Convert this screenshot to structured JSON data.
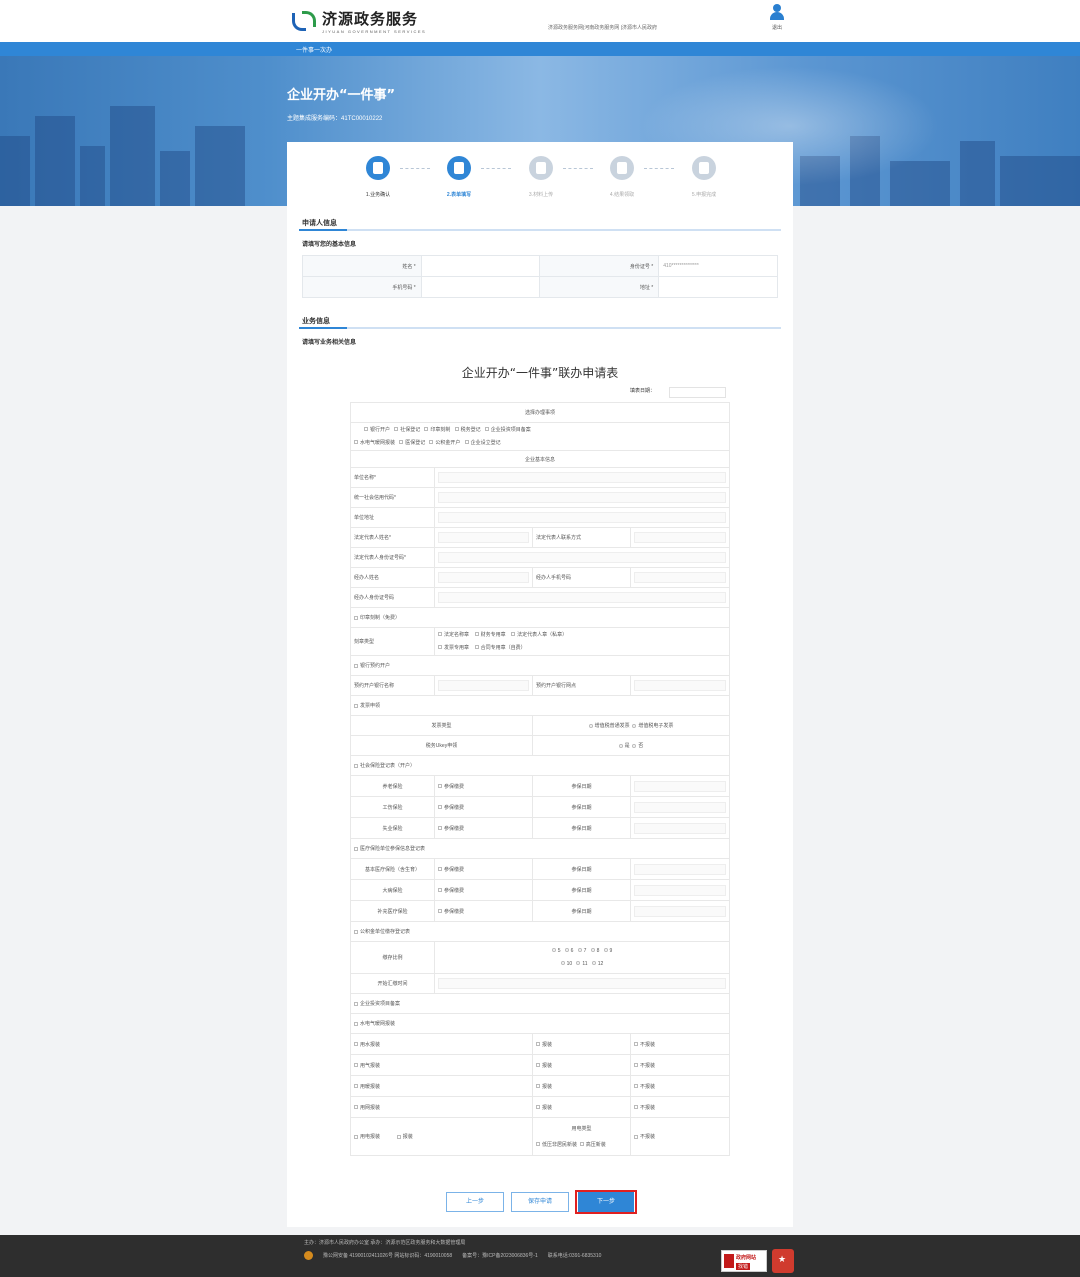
{
  "header": {
    "logo_cn": "济源政务服务",
    "logo_en": "JIYUAN GOVERNMENT SERVICES",
    "links": "济源政务服务网|河南政务服务网 |济源市人民政府",
    "logout": "退出",
    "nav": "一件事一次办"
  },
  "banner": {
    "title": "企业开办“一件事”",
    "code_label": "主题集成服务编码：",
    "code": "41TC00010222"
  },
  "steps": [
    {
      "label": "1.业务确认",
      "state": "done"
    },
    {
      "label": "2.表单填写",
      "state": "active"
    },
    {
      "label": "3.材料上传",
      "state": "todo"
    },
    {
      "label": "4.结果领取",
      "state": "todo"
    },
    {
      "label": "5.申报完成",
      "state": "todo"
    }
  ],
  "applicant": {
    "title": "申请人信息",
    "hint": "请填写您的基本信息",
    "name_label": "姓名 *",
    "id_label": "身份证号 *",
    "id_value": "410**************",
    "phone_label": "手机号码 *",
    "address_label": "地址 *"
  },
  "business": {
    "title": "业务信息",
    "hint": "请填写业务相关信息"
  },
  "form": {
    "title": "企业开办“一件事”联办申请表",
    "date_label": "填表日期：",
    "select_items": "选择办理事项",
    "items_row1": [
      "银行开户",
      "社保登记",
      "印章刻制",
      "税务登记",
      "企业投资项目备案"
    ],
    "items_row2": [
      "水电气暖网报装",
      "医保登记",
      "公积金开户",
      "企业设立登记"
    ],
    "basic_info": "企业基本信息",
    "unit_name": "单位名称*",
    "credit_code": "统一社会信用代码*",
    "unit_address": "单位地址",
    "legal_name": "法定代表人姓名*",
    "legal_contact": "法定代表人联系方式",
    "legal_id": "法定代表人身份证号码*",
    "agent_name": "经办人姓名",
    "agent_phone": "经办人手机号码",
    "agent_id": "经办人身份证号码",
    "seal_section": "印章刻制（免费）",
    "seal_type": "刻章类型",
    "seal_opts_row1": [
      "法定名称章",
      "财务专用章",
      "法定代表人章（私章）"
    ],
    "seal_opts_row2": [
      "发票专用章",
      "合同专用章（自费）"
    ],
    "bank_section": "银行预约开户",
    "bank_name": "预约开户银行名称",
    "bank_branch": "预约开户银行网点",
    "invoice_section": "发票申领",
    "invoice_type": "发票类型",
    "invoice_opts": [
      "增值税普通发票",
      "增值税电子发票"
    ],
    "ukey": "税务Ukey申领",
    "yes": "是",
    "no": "否",
    "social_section": "社会保险登记表（开户）",
    "pension": "养老保险",
    "injury": "工伤保险",
    "unemployment": "失业保险",
    "insure": "参保缴费",
    "insure_date": "参保日期",
    "medical_section": "医疗保险单位参保信息登记表",
    "basic_medical": "基本医疗保险（含生育）",
    "serious_illness": "大病保险",
    "supplementary": "补充医疗保险",
    "fund_section": "公积金单位缴存登记表",
    "deposit_ratio": "缴存比例",
    "ratios_row1": [
      "5",
      "6",
      "7",
      "8",
      "9"
    ],
    "ratios_row2": [
      "10",
      "11",
      "12"
    ],
    "start_month": "开始汇缴时间",
    "project_section": "企业投资项目备案",
    "utility_section": "水电气暖网报装",
    "utilities": [
      "用水报装",
      "用气报装",
      "用暖报装",
      "用网报装",
      "用电报装"
    ],
    "apply": "报装",
    "no_apply": "不报装",
    "power_type": "用电类型",
    "power_opts": [
      "低压非居民新装",
      "高压新装"
    ]
  },
  "buttons": {
    "prev": "上一步",
    "save": "保存申请",
    "next": "下一步"
  },
  "footer": {
    "line1": "主办：济源市人民政府办公室   承办：济源示范区政务服务和大数据管理局",
    "beian": "豫公网安备 41900102411026号 网站标识码：4190010058",
    "icp": "备案号：豫ICP备2023006836号-1",
    "phone": "联系电话:0391-6835310",
    "gov_badge_top": "政府网站",
    "gov_badge_bottom": "找错"
  },
  "colors": {
    "accent": "#2f86d6",
    "done": "#2f86d6",
    "todo": "#c9d3de",
    "highlight": "#e02020"
  }
}
